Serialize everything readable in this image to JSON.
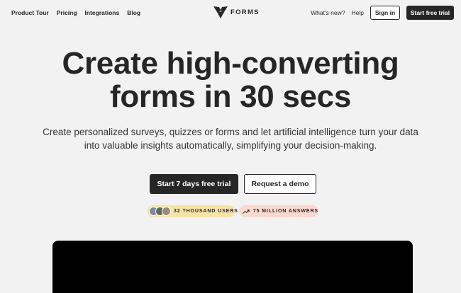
{
  "nav": {
    "links": [
      "Product Tour",
      "Pricing",
      "Integrations",
      "Blog"
    ],
    "logo_text": "FORMS",
    "whats_new": "What's new?",
    "help": "Help",
    "sign_in": "Sign in",
    "start_trial": "Start free trial"
  },
  "hero": {
    "title_line1": "Create high-converting",
    "title_line2": "forms in 30 secs",
    "subtitle_line1": "Create personalized surveys, quizzes or forms and let artificial intelligence turn your data",
    "subtitle_line2": "into valuable insights automatically, simplifying your decision-making.",
    "primary_cta": "Start 7 days free trial",
    "secondary_cta": "Request a demo"
  },
  "badges": {
    "users": "32 THOUSAND USERS",
    "answers": "75 MILLION ANSWERS"
  },
  "colors": {
    "background": "#f2f2f2",
    "dark": "#262626",
    "users_badge": "#f8e3a7",
    "answers_badge": "#fbd9cf",
    "video_bg": "#000000"
  },
  "icons": [
    "logo-mark-icon",
    "avatar-icon",
    "trend-up-icon"
  ]
}
